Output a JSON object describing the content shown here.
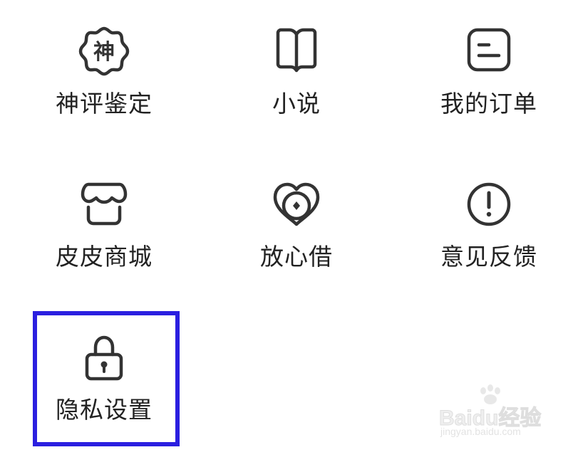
{
  "menu": {
    "items": [
      {
        "label": "神评鉴定",
        "icon": "shen-badge-icon",
        "badge_char": "神"
      },
      {
        "label": "小说",
        "icon": "book-icon"
      },
      {
        "label": "我的订单",
        "icon": "order-list-icon"
      },
      {
        "label": "皮皮商城",
        "icon": "storefront-icon"
      },
      {
        "label": "放心借",
        "icon": "heart-coin-icon"
      },
      {
        "label": "意见反馈",
        "icon": "exclamation-circle-icon"
      },
      {
        "label": "隐私设置",
        "icon": "lock-icon"
      }
    ]
  },
  "highlight": {
    "target": "隐私设置",
    "color": "#2b1fe0"
  },
  "watermark": {
    "main": "Baidu经验",
    "sub": "jingyan.baidu.com"
  },
  "colors": {
    "icon_stroke": "#333333",
    "label_text": "#222222",
    "background": "#ffffff"
  }
}
